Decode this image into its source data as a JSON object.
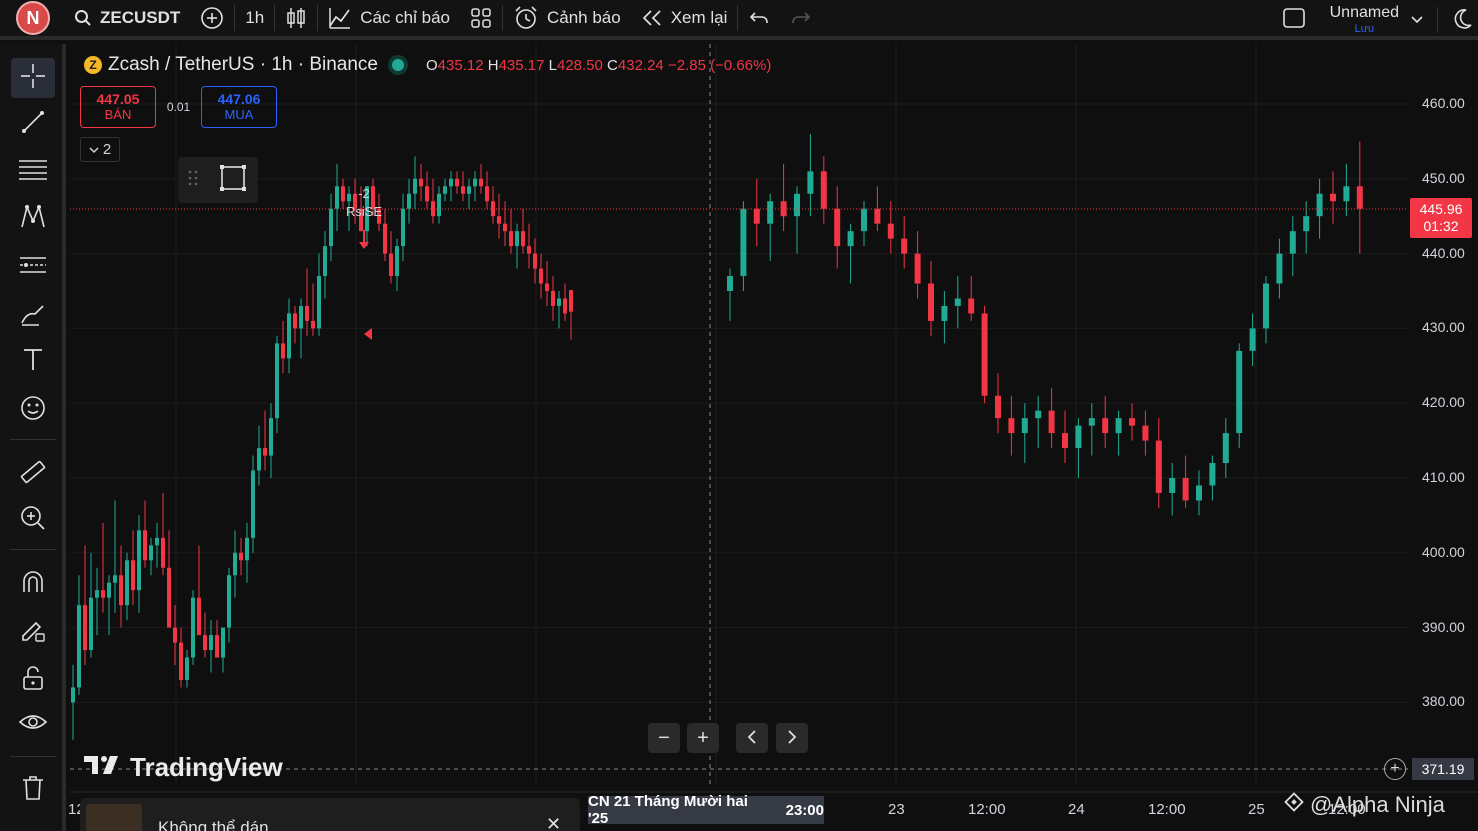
{
  "topbar": {
    "avatar_letter": "N",
    "symbol": "ZECUSDT",
    "interval": "1h",
    "indicators_label": "Các chỉ báo",
    "alerts_label": "Cảnh báo",
    "replay_label": "Xem lại",
    "layout_name": "Unnamed",
    "save_label": "Lưu"
  },
  "legend": {
    "logo_letter": "Z",
    "title": "Zcash / TetherUS · 1h · Binance",
    "o_label": "O",
    "o": "435.12",
    "h_label": "H",
    "h": "435.17",
    "l_label": "L",
    "l": "428.50",
    "c_label": "C",
    "c": "432.24",
    "change": "−2.85 (−0.66%)"
  },
  "trade": {
    "sell_price": "447.05",
    "sell_label": "BÁN",
    "spread": "0.01",
    "buy_price": "447.06",
    "buy_label": "MUA"
  },
  "collapse_count": "2",
  "annotation": {
    "value": "-2",
    "name": "RsiSE"
  },
  "branding": {
    "logo_text": "TradingView",
    "watermark": "@Alpha Ninja"
  },
  "price_axis": {
    "current_price": "445.96",
    "countdown": "01:32",
    "crosshair_price": "371.19"
  },
  "time_axis": {
    "labels": [
      "12",
      "23",
      "12:00",
      "24",
      "12:00",
      "25",
      "12:00"
    ],
    "crosshair_date": "CN 21 Tháng Mười hai '25",
    "crosshair_time": "23:00"
  },
  "toast": {
    "message": "Không thể dán"
  },
  "colors": {
    "up": "#22ab94",
    "down": "#f23645",
    "background": "#0f0f0f",
    "accent": "#2962ff"
  },
  "chart_data": {
    "type": "candlestick",
    "y_axis_ticks": [
      "460.00",
      "450.00",
      "440.00",
      "430.00",
      "420.00",
      "410.00",
      "400.00",
      "390.00",
      "380.00"
    ],
    "ylim": [
      371,
      466
    ],
    "grid": true,
    "current_price_line": 445.96,
    "series": [
      {
        "values": [
          [
            380.0,
            385.0,
            375.0,
            382.0
          ],
          [
            382.0,
            397.0,
            381.0,
            393.0
          ],
          [
            393.0,
            401.0,
            385.0,
            387.0
          ],
          [
            387.0,
            400.0,
            386.0,
            394.0
          ],
          [
            394.0,
            398.0,
            389.0,
            395.0
          ],
          [
            395.0,
            404.0,
            392.0,
            394.0
          ],
          [
            394.0,
            397.0,
            389.0,
            396.0
          ],
          [
            396.0,
            407.0,
            392.0,
            397.0
          ],
          [
            397.0,
            401.0,
            390.0,
            393.0
          ],
          [
            393.0,
            400.0,
            391.0,
            399.0
          ],
          [
            399.0,
            403.0,
            393.0,
            395.0
          ],
          [
            395.0,
            405.0,
            392.0,
            403.0
          ],
          [
            403.0,
            407.0,
            398.0,
            399.0
          ],
          [
            399.0,
            402.0,
            397.0,
            401.0
          ],
          [
            401.0,
            404.0,
            398.0,
            402.0
          ],
          [
            402.0,
            408.0,
            397.0,
            398.0
          ],
          [
            398.0,
            403.0,
            394.0,
            390.0
          ],
          [
            390.0,
            393.0,
            385.0,
            388.0
          ],
          [
            388.0,
            390.0,
            382.0,
            383.0
          ],
          [
            383.0,
            387.0,
            382.0,
            386.0
          ],
          [
            386.0,
            395.0,
            385.0,
            394.0
          ],
          [
            394.0,
            401.0,
            390.0,
            389.0
          ],
          [
            389.0,
            392.0,
            386.0,
            387.0
          ],
          [
            387.0,
            391.0,
            384.0,
            389.0
          ],
          [
            389.0,
            391.0,
            386.0,
            386.0
          ],
          [
            386.0,
            389.0,
            384.0,
            390.0
          ],
          [
            390.0,
            398.0,
            388.0,
            397.0
          ],
          [
            397.0,
            403.0,
            394.0,
            400.0
          ],
          [
            400.0,
            402.0,
            397.0,
            399.0
          ],
          [
            399.0,
            404.0,
            396.0,
            402.0
          ],
          [
            402.0,
            413.0,
            400.0,
            411.0
          ],
          [
            411.0,
            417.0,
            409.0,
            414.0
          ],
          [
            414.0,
            419.0,
            411.0,
            413.0
          ],
          [
            413.0,
            420.0,
            410.0,
            418.0
          ],
          [
            418.0,
            429.0,
            416.0,
            428.0
          ],
          [
            428.0,
            431.0,
            424.0,
            426.0
          ],
          [
            426.0,
            434.0,
            424.0,
            432.0
          ],
          [
            432.0,
            433.0,
            428.0,
            430.0
          ],
          [
            430.0,
            434.0,
            426.0,
            433.0
          ],
          [
            433.0,
            438.0,
            429.0,
            431.0
          ],
          [
            431.0,
            436.0,
            429.0,
            430.0
          ],
          [
            430.0,
            440.0,
            429.0,
            437.0
          ],
          [
            437.0,
            443.0,
            434.0,
            441.0
          ],
          [
            441.0,
            448.0,
            439.0,
            446.0
          ],
          [
            446.0,
            452.0,
            443.0,
            449.0
          ],
          [
            449.0,
            450.0,
            446.0,
            447.0
          ],
          [
            447.0,
            449.0,
            443.0,
            448.0
          ],
          [
            448.0,
            450.0,
            444.0,
            446.0
          ],
          [
            446.0,
            449.0,
            443.0,
            443.0
          ],
          [
            443.0,
            446.0,
            441.0,
            449.0
          ],
          [
            449.0,
            450.0,
            445.0,
            446.0
          ],
          [
            446.0,
            448.0,
            443.0,
            444.0
          ],
          [
            444.0,
            446.0,
            439.0,
            440.0
          ],
          [
            440.0,
            443.0,
            436.0,
            437.0
          ],
          [
            437.0,
            442.0,
            435.0,
            441.0
          ],
          [
            441.0,
            448.0,
            439.0,
            446.0
          ],
          [
            446.0,
            450.0,
            444.0,
            448.0
          ],
          [
            448.0,
            453.0,
            446.0,
            450.0
          ],
          [
            450.0,
            452.0,
            447.0,
            449.0
          ],
          [
            449.0,
            451.0,
            446.0,
            447.0
          ],
          [
            447.0,
            450.0,
            444.0,
            445.0
          ],
          [
            445.0,
            449.0,
            444.0,
            448.0
          ],
          [
            448.0,
            450.0,
            447.0,
            449.0
          ],
          [
            449.0,
            451.0,
            447.0,
            450.0
          ],
          [
            450.0,
            451.0,
            448.0,
            449.0
          ],
          [
            449.0,
            451.0,
            447.0,
            448.0
          ],
          [
            448.0,
            450.0,
            446.0,
            449.0
          ],
          [
            449.0,
            451.0,
            447.0,
            450.0
          ],
          [
            450.0,
            452.0,
            448.0,
            449.0
          ],
          [
            449.0,
            451.0,
            446.0,
            447.0
          ],
          [
            447.0,
            449.0,
            444.0,
            445.0
          ],
          [
            445.0,
            448.0,
            442.0,
            444.0
          ],
          [
            444.0,
            447.0,
            441.0,
            443.0
          ],
          [
            443.0,
            446.0,
            440.0,
            441.0
          ],
          [
            441.0,
            444.0,
            438.0,
            443.0
          ],
          [
            443.0,
            446.0,
            440.0,
            441.0
          ],
          [
            441.0,
            444.0,
            438.0,
            440.0
          ],
          [
            440.0,
            442.0,
            436.0,
            438.0
          ],
          [
            438.0,
            440.0,
            434.0,
            436.0
          ],
          [
            436.0,
            439.0,
            433.0,
            435.0
          ],
          [
            435.0,
            437.0,
            431.0,
            433.0
          ],
          [
            433.0,
            435.0,
            430.0,
            434.0
          ],
          [
            434.0,
            436.0,
            431.0,
            432.0
          ],
          [
            435.12,
            435.17,
            428.5,
            432.24
          ]
        ]
      }
    ]
  }
}
